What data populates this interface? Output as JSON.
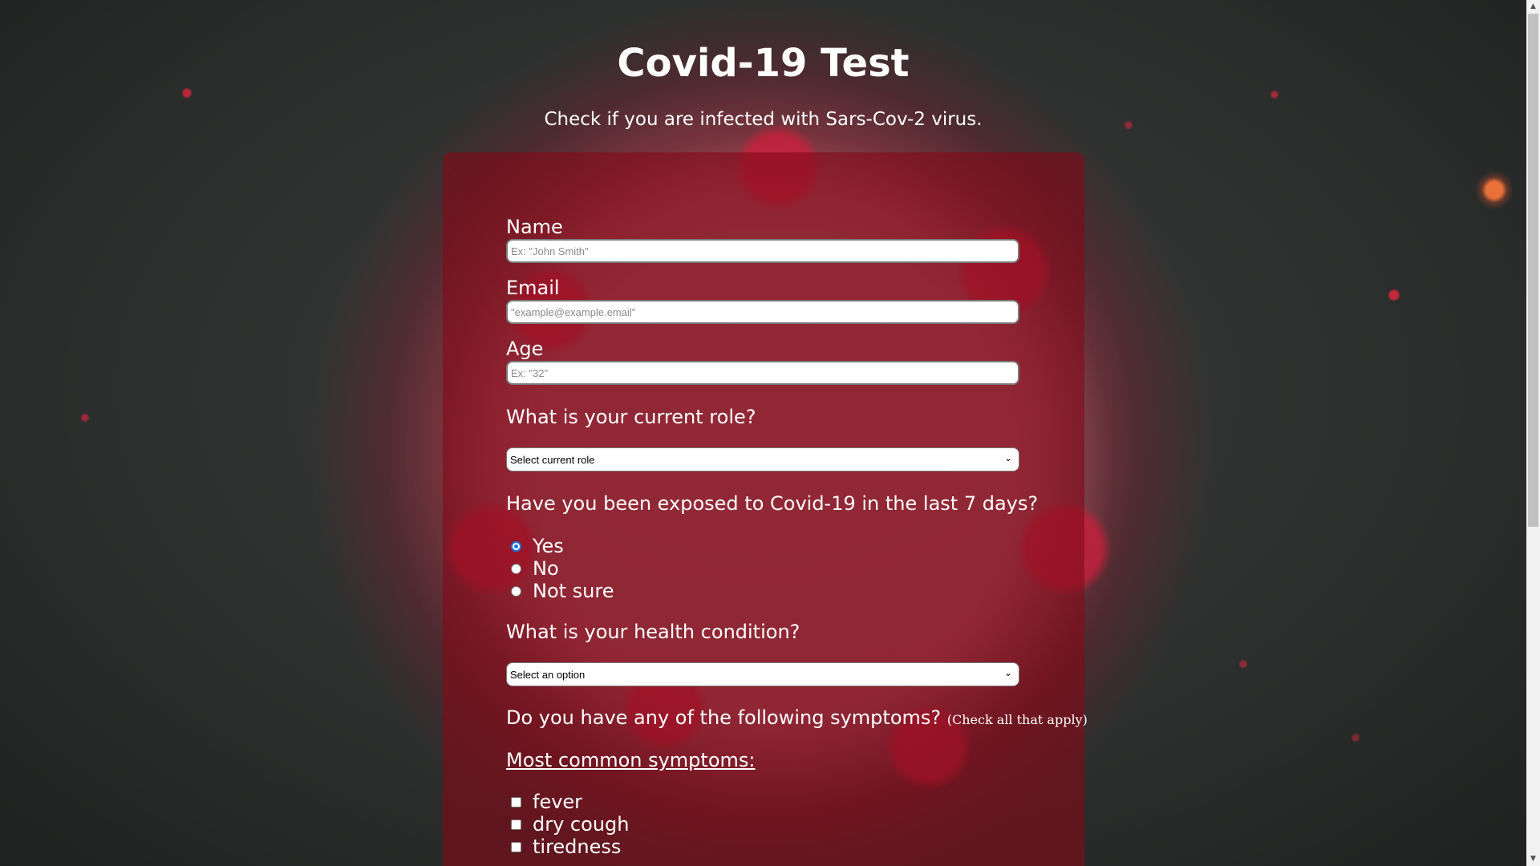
{
  "page": {
    "title": "Covid-19 Test",
    "subtitle": "Check if you are infected with Sars-Cov-2 virus."
  },
  "form": {
    "name": {
      "label": "Name",
      "placeholder": "Ex: \"John Smith\"",
      "value": ""
    },
    "email": {
      "label": "Email",
      "placeholder": "\"example@example.email\"",
      "value": ""
    },
    "age": {
      "label": "Age",
      "placeholder": "Ex: \"32\"",
      "value": ""
    },
    "role": {
      "question": "What is your current role?",
      "selected": "Select current role"
    },
    "exposure": {
      "question": "Have you been exposed to Covid-19 in the last 7 days?",
      "options": [
        {
          "label": "Yes",
          "checked": true
        },
        {
          "label": "No",
          "checked": false
        },
        {
          "label": "Not sure",
          "checked": false
        }
      ]
    },
    "health": {
      "question": "What is your health condition?",
      "selected": "Select an option"
    },
    "symptoms": {
      "question": "Do you have any of the following symptoms?",
      "note": "(Check all that apply)",
      "common_heading": "Most common symptoms:",
      "common": [
        {
          "label": "fever",
          "checked": false
        },
        {
          "label": "dry cough",
          "checked": false
        },
        {
          "label": "tiredness",
          "checked": false
        }
      ]
    }
  },
  "colors": {
    "panel": "#820a19",
    "radio_accent": "#1a73e8",
    "background": "#2e302f"
  },
  "icons": {
    "select_arrow": "chevron-down-icon",
    "scroll_up": "scroll-up-arrow-icon",
    "scroll_down": "scroll-down-arrow-icon"
  }
}
